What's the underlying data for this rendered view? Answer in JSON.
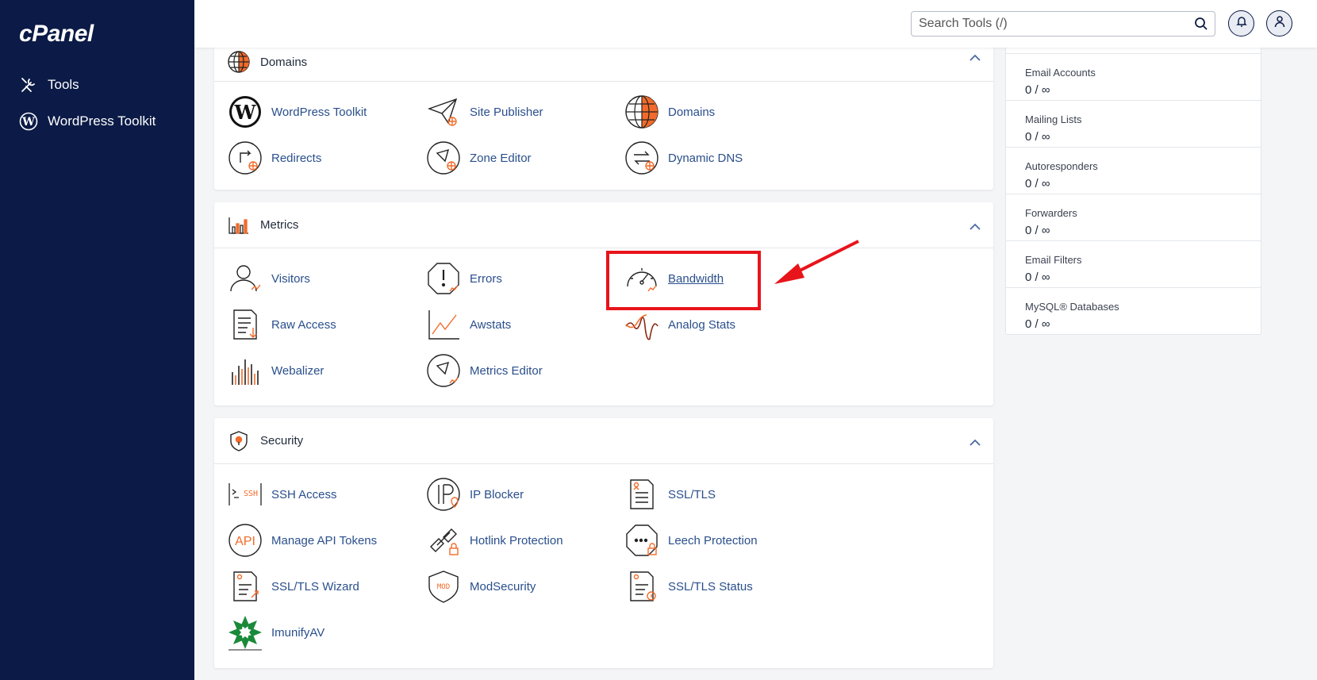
{
  "sidebar": {
    "logo": "cPanel",
    "items": [
      {
        "label": "Tools",
        "icon": "tools-icon"
      },
      {
        "label": "WordPress Toolkit",
        "icon": "wordpress-icon"
      }
    ]
  },
  "header": {
    "search_placeholder": "Search Tools (/)"
  },
  "domains": {
    "title": "Domains",
    "tools": [
      {
        "label": "WordPress Toolkit",
        "icon": "wordpress-toolkit-icon"
      },
      {
        "label": "Site Publisher",
        "icon": "site-publisher-icon"
      },
      {
        "label": "Domains",
        "icon": "domains-globe-icon"
      },
      {
        "label": "Redirects",
        "icon": "redirects-icon"
      },
      {
        "label": "Zone Editor",
        "icon": "zone-editor-icon"
      },
      {
        "label": "Dynamic DNS",
        "icon": "dynamic-dns-icon"
      }
    ]
  },
  "metrics": {
    "title": "Metrics",
    "tools": [
      {
        "label": "Visitors",
        "icon": "visitors-icon"
      },
      {
        "label": "Errors",
        "icon": "errors-icon"
      },
      {
        "label": "Bandwidth",
        "icon": "bandwidth-icon"
      },
      {
        "label": "Raw Access",
        "icon": "raw-access-icon"
      },
      {
        "label": "Awstats",
        "icon": "awstats-icon"
      },
      {
        "label": "Analog Stats",
        "icon": "analog-stats-icon"
      },
      {
        "label": "Webalizer",
        "icon": "webalizer-icon"
      },
      {
        "label": "Metrics Editor",
        "icon": "metrics-editor-icon"
      }
    ]
  },
  "security": {
    "title": "Security",
    "tools": [
      {
        "label": "SSH Access",
        "icon": "ssh-access-icon",
        "icon_text": "SSH"
      },
      {
        "label": "IP Blocker",
        "icon": "ip-blocker-icon"
      },
      {
        "label": "SSL/TLS",
        "icon": "ssl-tls-icon"
      },
      {
        "label": "Manage API Tokens",
        "icon": "api-tokens-icon",
        "icon_text": "API"
      },
      {
        "label": "Hotlink Protection",
        "icon": "hotlink-protection-icon"
      },
      {
        "label": "Leech Protection",
        "icon": "leech-protection-icon"
      },
      {
        "label": "SSL/TLS Wizard",
        "icon": "ssl-tls-wizard-icon"
      },
      {
        "label": "ModSecurity",
        "icon": "modsecurity-icon",
        "icon_text": "MOD"
      },
      {
        "label": "SSL/TLS Status",
        "icon": "ssl-tls-status-icon"
      },
      {
        "label": "ImunifyAV",
        "icon": "imunifyav-icon"
      }
    ]
  },
  "stats": [
    {
      "label": "Email Accounts",
      "value": "0 / ∞"
    },
    {
      "label": "Mailing Lists",
      "value": "0 / ∞"
    },
    {
      "label": "Autoresponders",
      "value": "0 / ∞"
    },
    {
      "label": "Forwarders",
      "value": "0 / ∞"
    },
    {
      "label": "Email Filters",
      "value": "0 / ∞"
    },
    {
      "label": "MySQL® Databases",
      "value": "0 / ∞"
    }
  ],
  "colors": {
    "sidebar": "#0b1a46",
    "link": "#2a4f8c",
    "accent_orange": "#f26b2a",
    "annotation_red": "#e8141b"
  }
}
